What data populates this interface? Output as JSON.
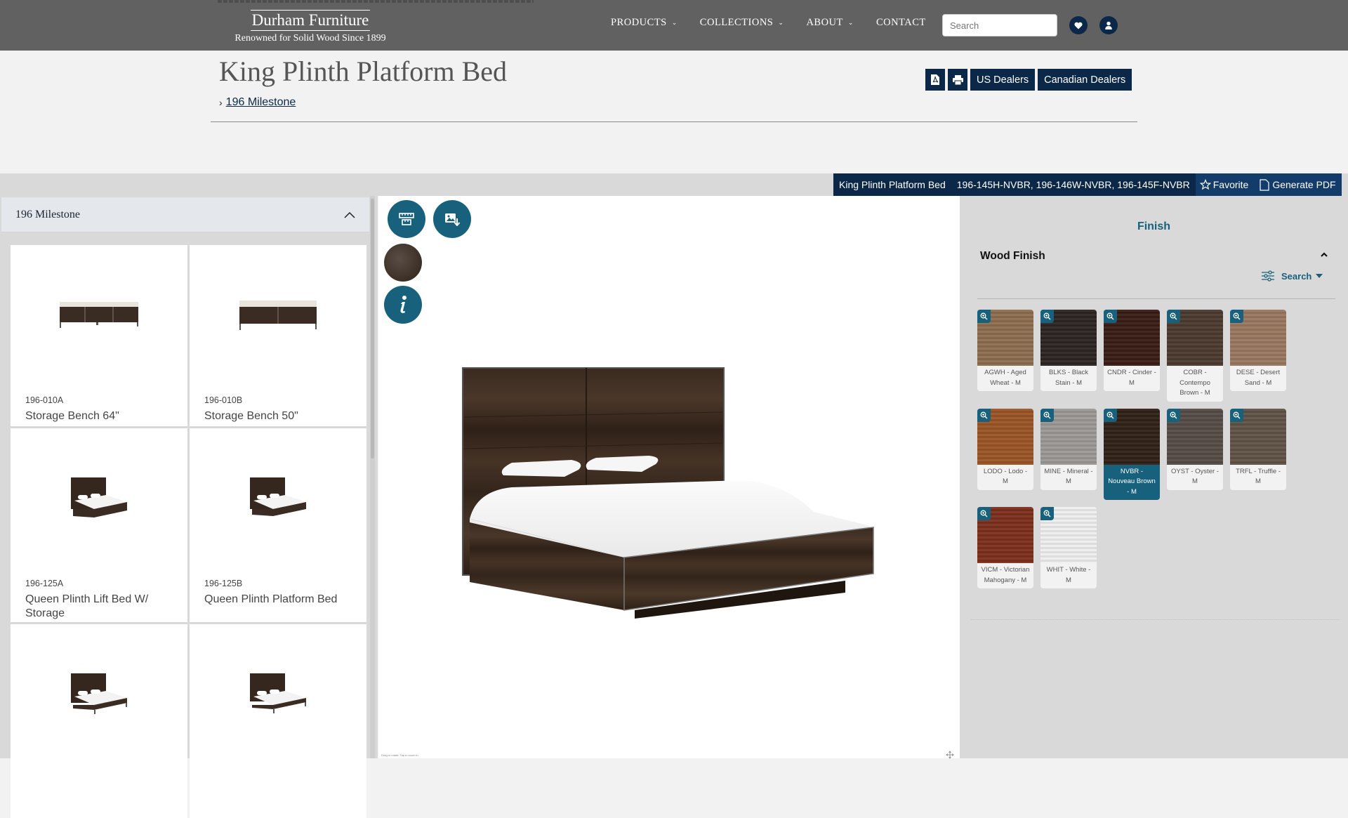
{
  "header": {
    "logo_name": "Durham Furniture",
    "logo_tagline": "Renowned for Solid Wood Since 1899",
    "nav": [
      {
        "label": "PRODUCTS",
        "dropdown": true
      },
      {
        "label": "COLLECTIONS",
        "dropdown": true
      },
      {
        "label": "ABOUT",
        "dropdown": true
      },
      {
        "label": "CONTACT",
        "dropdown": false
      }
    ],
    "search_placeholder": "Search",
    "favorites_icon": "heart-icon",
    "account_icon": "user-icon"
  },
  "page": {
    "title": "King Plinth Platform Bed",
    "breadcrumb": "196 Milestone",
    "actions": {
      "pdf_icon": "pdf-icon",
      "print_icon": "print-icon",
      "us_dealers": "US Dealers",
      "canadian_dealers": "Canadian Dealers"
    }
  },
  "infobar": {
    "product_name": "King Plinth Platform Bed",
    "skus": "196-145H-NVBR, 196-146W-NVBR, 196-145F-NVBR",
    "favorite": "Favorite",
    "generate_pdf": "Generate PDF"
  },
  "collection_panel": {
    "title": "196 Milestone",
    "items": [
      {
        "sku": "196-010A",
        "name": "Storage Bench 64\"",
        "kind": "bench"
      },
      {
        "sku": "196-010B",
        "name": "Storage Bench 50\"",
        "kind": "bench"
      },
      {
        "sku": "196-125A",
        "name": "Queen Plinth Lift Bed W/ Storage",
        "kind": "bed"
      },
      {
        "sku": "196-125B",
        "name": "Queen Plinth Platform Bed",
        "kind": "bed"
      },
      {
        "sku": "",
        "name": "",
        "kind": "bed"
      },
      {
        "sku": "",
        "name": "",
        "kind": "bed"
      }
    ]
  },
  "viewer": {
    "dimensions_icon": "ruler-icon",
    "download_image_icon": "image-download-icon",
    "selected_finish_color": "#2f2117",
    "info_icon": "info-icon",
    "hint": "Drag to rotate. Tap to zoom in."
  },
  "finish_panel": {
    "heading": "Finish",
    "group": "Wood Finish",
    "filter_label": "Search",
    "swatches": [
      {
        "label": "AGWH - Aged Wheat - M",
        "color": "#8d6e4f",
        "selected": false
      },
      {
        "label": "BLKS - Black Stain - M",
        "color": "#2d2522",
        "selected": false
      },
      {
        "label": "CNDR - Cinder - M",
        "color": "#3a1d16",
        "selected": false
      },
      {
        "label": "COBR - Contempo Brown - M",
        "color": "#4c3a2f",
        "selected": false
      },
      {
        "label": "DESE - Desert Sand - M",
        "color": "#9a7760",
        "selected": false
      },
      {
        "label": "LODO - Lodo - M",
        "color": "#9b5426",
        "selected": false
      },
      {
        "label": "MINE - Mineral - M",
        "color": "#9b9895",
        "selected": false
      },
      {
        "label": "NVBR - Nouveau Brown - M",
        "color": "#2f2117",
        "selected": true
      },
      {
        "label": "OYST - Oyster - M",
        "color": "#564c47",
        "selected": false
      },
      {
        "label": "TRFL - Truffle - M",
        "color": "#605246",
        "selected": false
      },
      {
        "label": "VICM - Victorian Mahogany - M",
        "color": "#7c2f1c",
        "selected": false
      },
      {
        "label": "WHIT - White - M",
        "color": "#eeeeee",
        "selected": false
      }
    ]
  }
}
